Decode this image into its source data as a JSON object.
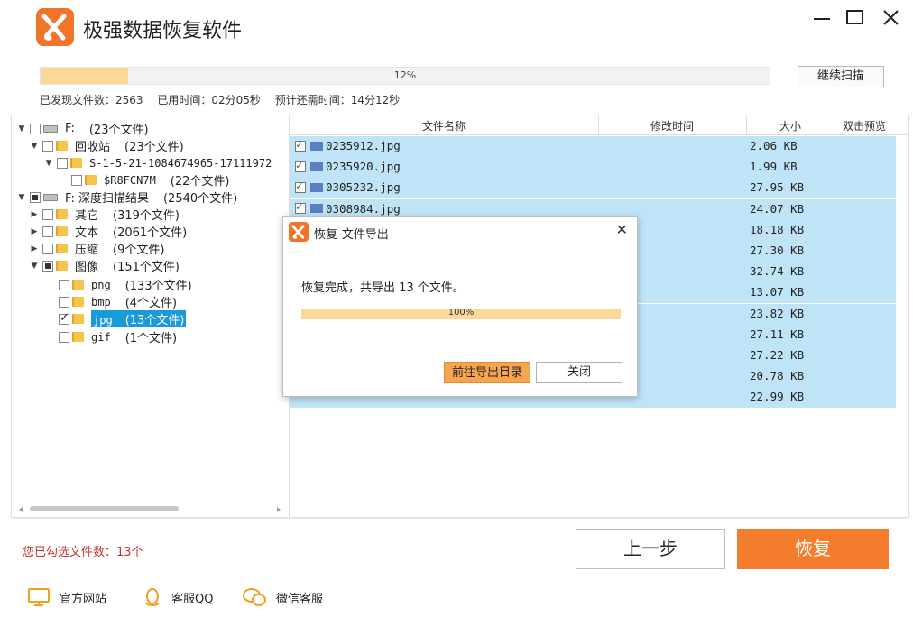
{
  "app": {
    "title": "极强数据恢复软件"
  },
  "colors": {
    "accent": "#f47c2d",
    "selection": "#1a9ad6",
    "row_highlight": "#bfe3f7",
    "progress": "#fbd898"
  },
  "scan": {
    "progress_text": "12%",
    "progress_value": 0.12,
    "continue_label": "继续扫描",
    "files_found": "已发现文件数：2563",
    "elapsed": "已用时间：02分05秒",
    "remaining": "预计还需时间：14分12秒"
  },
  "tree": [
    {
      "label": "F:",
      "count": "(23个文件)"
    },
    {
      "label": "回收站",
      "count": "(23个文件)"
    },
    {
      "label": "S-1-5-21-1084674965-17111972",
      "count": ""
    },
    {
      "label": "$R8FCN7M",
      "count": "(22个文件)"
    },
    {
      "label": "F: 深度扫描结果",
      "count": "(2540个文件)"
    },
    {
      "label": "其它",
      "count": "(319个文件)"
    },
    {
      "label": "文本",
      "count": "(2061个文件)"
    },
    {
      "label": "压缩",
      "count": "(9个文件)"
    },
    {
      "label": "图像",
      "count": "(151个文件)"
    },
    {
      "label": "png",
      "count": "(133个文件)"
    },
    {
      "label": "bmp",
      "count": "(4个文件)"
    },
    {
      "label": "jpg",
      "count": "(13个文件)"
    },
    {
      "label": "gif",
      "count": "(1个文件)"
    }
  ],
  "table": {
    "headers": {
      "name": "文件名称",
      "modified": "修改时间",
      "size": "大小",
      "preview": "双击预览"
    },
    "rows": [
      {
        "name": "0235912.jpg",
        "size": "2.06 KB"
      },
      {
        "name": "0235920.jpg",
        "size": "1.99 KB"
      },
      {
        "name": "0305232.jpg",
        "size": "27.95 KB"
      },
      {
        "name": "0308984.jpg",
        "size": "24.07 KB"
      },
      {
        "name": "",
        "size": "18.18 KB"
      },
      {
        "name": "",
        "size": "27.30 KB"
      },
      {
        "name": "",
        "size": "32.74 KB"
      },
      {
        "name": "",
        "size": "13.07 KB"
      },
      {
        "name": "",
        "size": "23.82 KB"
      },
      {
        "name": "",
        "size": "27.11 KB"
      },
      {
        "name": "",
        "size": "27.22 KB"
      },
      {
        "name": "",
        "size": "20.78 KB"
      },
      {
        "name": "",
        "size": "22.99 KB"
      }
    ]
  },
  "bottom": {
    "selected_count": "您已勾选文件数：13个",
    "prev_label": "上一步",
    "restore_label": "恢复"
  },
  "footer": {
    "website": "官方网站",
    "qq": "客服QQ",
    "wechat": "微信客服"
  },
  "dialog": {
    "title": "恢复-文件导出",
    "message": "恢复完成，共导出 13 个文件。",
    "progress_text": "100%",
    "open_dir_label": "前往导出目录",
    "close_label": "关闭"
  }
}
